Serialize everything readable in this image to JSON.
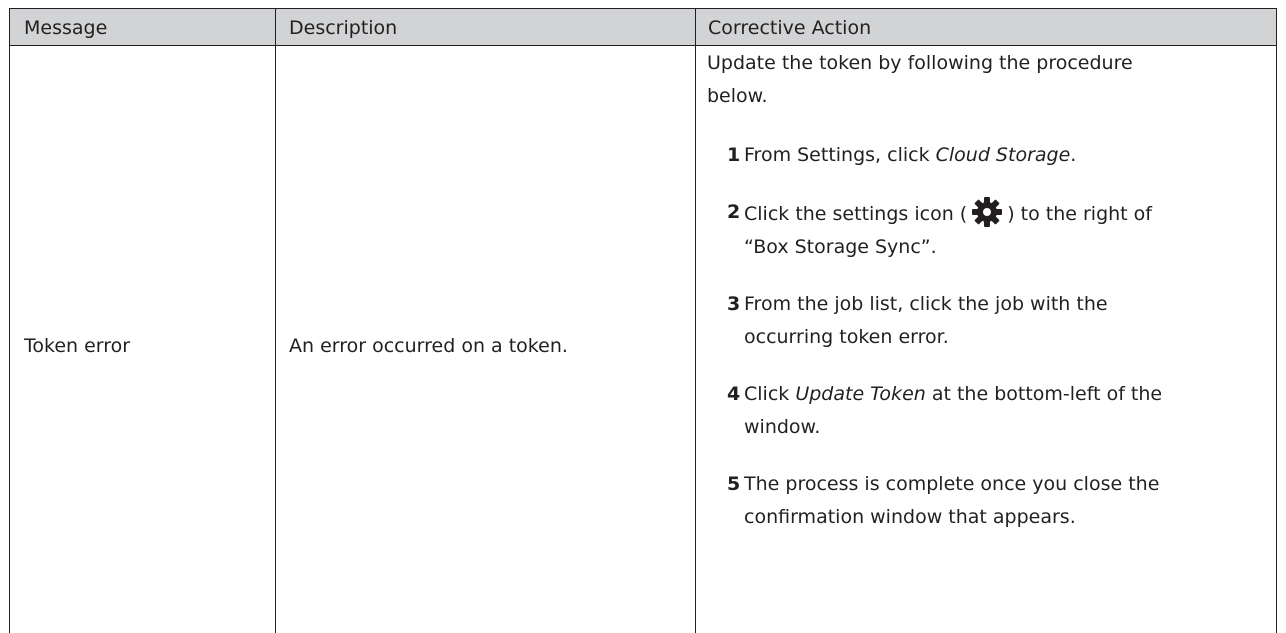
{
  "table": {
    "headers": [
      "Message",
      "Description",
      "Corrective Action"
    ],
    "row": {
      "message": "Token error",
      "description": "An error occurred on a token.",
      "action_intro_line1": "Update the token by following the procedure",
      "action_intro_line2": "below.",
      "steps": [
        {
          "num": "1",
          "pre": "From Settings, click ",
          "em": "Cloud Storage",
          "post": "."
        },
        {
          "num": "2",
          "pre": "Click the settings icon (",
          "post_icon": ") to the right of",
          "line2": "“Box Storage Sync”."
        },
        {
          "num": "3",
          "line1": "From the job list, click the job with the",
          "line2": "occurring token error."
        },
        {
          "num": "4",
          "pre": "Click ",
          "em": "Update Token",
          "post": " at the bottom-left of the",
          "line2": "window."
        },
        {
          "num": "5",
          "line1": "The process is complete once you close the",
          "line2": "confirmation window that appears."
        }
      ]
    }
  },
  "colors": {
    "header_bg": "#d1d3d4",
    "border": "#231f20",
    "text": "#231f20",
    "icon": "#231f20"
  },
  "icons": {
    "settings": "gear-icon"
  }
}
